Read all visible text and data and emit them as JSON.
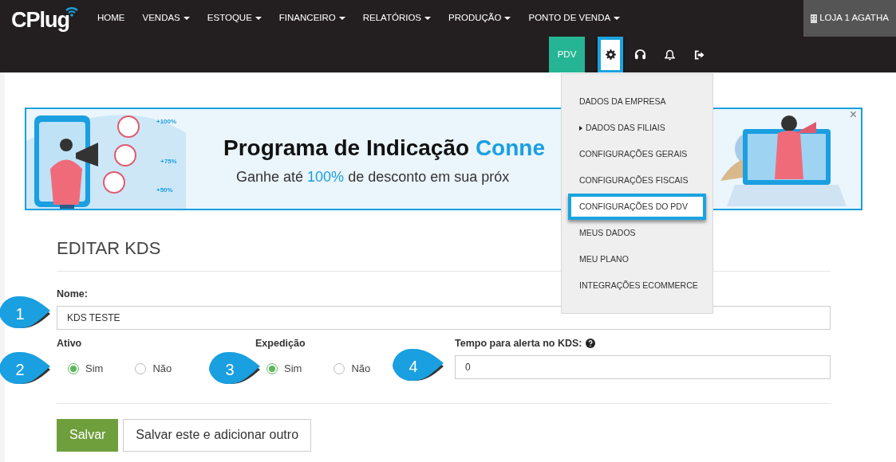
{
  "navbar": {
    "logo": "CPlug",
    "menu": [
      {
        "label": "HOME",
        "dropdown": false
      },
      {
        "label": "VENDAS",
        "dropdown": true
      },
      {
        "label": "ESTOQUE",
        "dropdown": true
      },
      {
        "label": "FINANCEIRO",
        "dropdown": true
      },
      {
        "label": "RELATÓRIOS",
        "dropdown": true
      },
      {
        "label": "PRODUÇÃO",
        "dropdown": true
      },
      {
        "label": "PONTO DE VENDA",
        "dropdown": true
      }
    ],
    "store": "LOJA 1 AGATHA",
    "toolbar": [
      {
        "kind": "text",
        "label": "PDV",
        "highlighted": false
      },
      {
        "kind": "gear",
        "highlighted": true
      },
      {
        "kind": "headset",
        "highlighted": false
      },
      {
        "kind": "bell",
        "highlighted": false
      },
      {
        "kind": "logout",
        "highlighted": false
      }
    ]
  },
  "settings_menu": [
    {
      "label": "DADOS DA EMPRESA",
      "submenu": false,
      "highlighted": false
    },
    {
      "label": "DADOS DAS FILIAIS",
      "submenu": true,
      "highlighted": false
    },
    {
      "label": "CONFIGURAÇÕES GERAIS",
      "submenu": false,
      "highlighted": false
    },
    {
      "label": "CONFIGURAÇÕES FISCAIS",
      "submenu": false,
      "highlighted": false
    },
    {
      "label": "CONFIGURAÇÕES DO PDV",
      "submenu": false,
      "highlighted": true
    },
    {
      "label": "MEUS DADOS",
      "submenu": false,
      "highlighted": false
    },
    {
      "label": "MEU PLANO",
      "submenu": false,
      "highlighted": false
    },
    {
      "label": "INTEGRAÇÕES ECOMMERCE",
      "submenu": false,
      "highlighted": false
    }
  ],
  "banner": {
    "title": "Programa de Indicação ",
    "title_accent": "Conne",
    "subtitle": "Ganhe até ",
    "subtitle_accent": "100%",
    "subtitle_rest": " de desconto em sua próx",
    "badges": [
      "+100%",
      "+75%",
      "+50%"
    ],
    "close": "×"
  },
  "form": {
    "title": "EDITAR KDS",
    "name": {
      "label": "Nome:",
      "value": "KDS TESTE",
      "callout": "1"
    },
    "groups": [
      {
        "kind": "radio",
        "label": "Ativo",
        "callout": "2",
        "options": [
          {
            "label": "Sim",
            "selected": true
          },
          {
            "label": "Não",
            "selected": false
          }
        ]
      },
      {
        "kind": "radio",
        "label": "Expedição",
        "callout": "3",
        "options": [
          {
            "label": "Sim",
            "selected": true
          },
          {
            "label": "Não",
            "selected": false
          }
        ]
      },
      {
        "kind": "input",
        "label": "Tempo para alerta no KDS:",
        "help": true,
        "value": "0",
        "callout": "4"
      }
    ],
    "buttons": [
      {
        "label": "Salvar",
        "primary": true
      },
      {
        "label": "Salvar este e adicionar outro",
        "primary": false
      }
    ]
  }
}
